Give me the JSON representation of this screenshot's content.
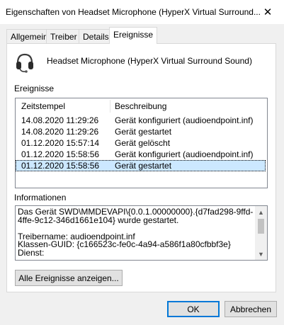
{
  "window": {
    "title": "Eigenschaften von Headset Microphone (HyperX Virtual Surround...",
    "close_glyph": "✕"
  },
  "tabs": [
    {
      "label": "Allgemein",
      "active": false
    },
    {
      "label": "Treiber",
      "active": false
    },
    {
      "label": "Details",
      "active": false
    },
    {
      "label": "Ereignisse",
      "active": true
    }
  ],
  "device": {
    "icon": "headset-icon",
    "name": "Headset Microphone (HyperX Virtual Surround Sound)"
  },
  "events": {
    "section_label": "Ereignisse",
    "columns": [
      "Zeitstempel",
      "Beschreibung"
    ],
    "rows": [
      {
        "timestamp": "14.08.2020 11:29:26",
        "description": "Gerät konfiguriert (audioendpoint.inf)",
        "selected": false
      },
      {
        "timestamp": "14.08.2020 11:29:26",
        "description": "Gerät gestartet",
        "selected": false
      },
      {
        "timestamp": "01.12.2020 15:57:14",
        "description": "Gerät gelöscht",
        "selected": false
      },
      {
        "timestamp": "01.12.2020 15:58:56",
        "description": "Gerät konfiguriert (audioendpoint.inf)",
        "selected": false
      },
      {
        "timestamp": "01.12.2020 15:58:56",
        "description": "Gerät gestartet",
        "selected": true
      }
    ],
    "selection_color": "#cce8ff"
  },
  "info": {
    "section_label": "Informationen",
    "text": "Das Gerät SWD\\MMDEVAPI\\{0.0.1.00000000}.{d7fad298-9ffd-4ffe-9c12-346d1661e104} wurde gestartet.\n\nTreibername: audioendpoint.inf\nKlassen-GUID: {c166523c-fe0c-4a94-a586f1a80cfbbf3e}\nDienst:"
  },
  "buttons": {
    "show_all": "Alle Ereignisse anzeigen...",
    "ok": "OK",
    "cancel": "Abbrechen"
  },
  "colors": {
    "accent": "#0078d7",
    "dialog_bg": "#f0f0f0"
  }
}
